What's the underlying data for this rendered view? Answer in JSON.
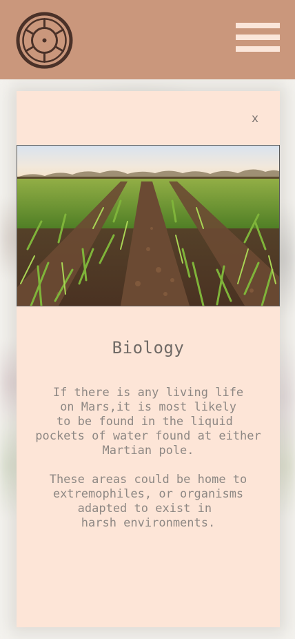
{
  "colors": {
    "header_bg": "#ca977c",
    "card_bg": "#fde5d7",
    "text": "#8e8884",
    "title": "#706a66"
  },
  "header": {
    "logo_icon": "ship-wheel-icon",
    "menu_icon": "hamburger-menu-icon"
  },
  "modal": {
    "close_label": "x",
    "image_description_icon": "crop-field-photo",
    "title": "Biology",
    "paragraph1": "If there is any living life\non Mars,it is most likely\nto be found in the liquid \npockets of water found at either\nMartian pole.",
    "paragraph2": "These areas could be home to\nextremophiles, or organisms\nadapted to exist in \nharsh environments."
  }
}
